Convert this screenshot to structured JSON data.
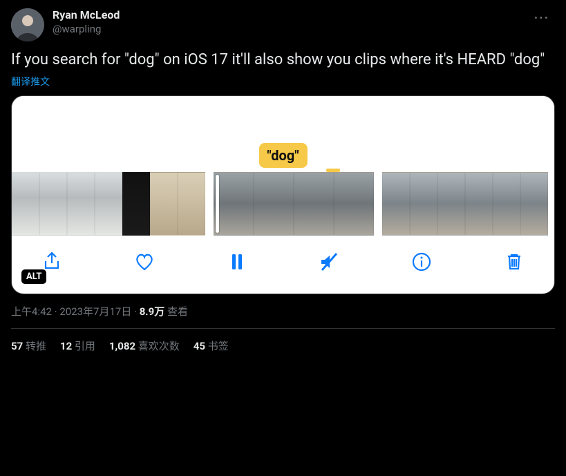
{
  "author": {
    "display_name": "Ryan McLeod",
    "handle": "@warpling"
  },
  "tweet": {
    "text": "If you search for \"dog\" on iOS 17 it'll also show you clips where it's HEARD \"dog\"",
    "translate_label": "翻译推文"
  },
  "media": {
    "tag_text": "\"dog\"",
    "alt_badge": "ALT",
    "controls": {
      "share": "share",
      "like": "like",
      "pause": "pause",
      "mute": "mute",
      "info": "info",
      "trash": "trash"
    }
  },
  "meta": {
    "time": "上午4:42",
    "date": "2023年7月17日",
    "views_count": "8.9万",
    "views_label": "查看",
    "separator": " · "
  },
  "stats": {
    "retweets": {
      "count": "57",
      "label": "转推"
    },
    "quotes": {
      "count": "12",
      "label": "引用"
    },
    "likes": {
      "count": "1,082",
      "label": "喜欢次数"
    },
    "bookmarks": {
      "count": "45",
      "label": "书签"
    }
  }
}
